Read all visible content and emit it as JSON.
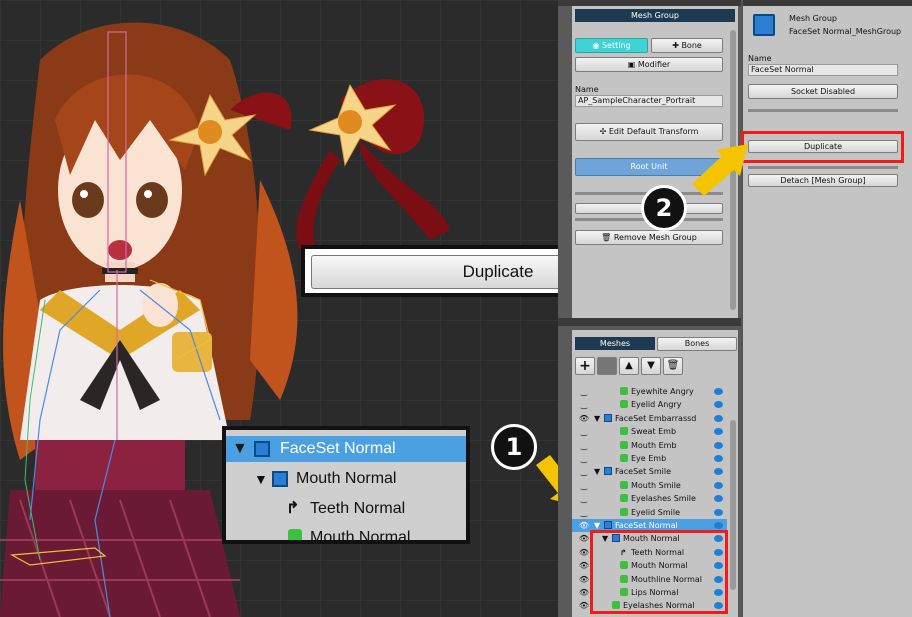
{
  "mid": {
    "header": "Mesh Group",
    "btn_setting": "Setting",
    "btn_bone": "Bone",
    "btn_modifier": "Modifier",
    "name_label": "Name",
    "name_value": "AP_SampleCharacter_Portrait",
    "btn_edit_default": "Edit Default Transform",
    "root_unit": "Root Unit",
    "btn_remove": "Remove Mesh Group",
    "tab_meshes": "Meshes",
    "tab_bones": "Bones"
  },
  "tree": [
    {
      "label": "Eyewhite Angry",
      "icon": "mesh",
      "indent": 2,
      "eye": "closed"
    },
    {
      "label": "Eyelid Angry",
      "icon": "mesh",
      "indent": 2,
      "eye": "closed"
    },
    {
      "label": "FaceSet Embarrassd",
      "icon": "group",
      "indent": 0,
      "eye": "open"
    },
    {
      "label": "Sweat Emb",
      "icon": "mesh",
      "indent": 2,
      "eye": "closed"
    },
    {
      "label": "Mouth Emb",
      "icon": "mesh",
      "indent": 2,
      "eye": "closed"
    },
    {
      "label": "Eye Emb",
      "icon": "mesh",
      "indent": 2,
      "eye": "closed"
    },
    {
      "label": "FaceSet Smile",
      "icon": "group",
      "indent": 0,
      "eye": "closed"
    },
    {
      "label": "Mouth Smile",
      "icon": "mesh",
      "indent": 2,
      "eye": "closed"
    },
    {
      "label": "Eyelashes Smile",
      "icon": "mesh",
      "indent": 2,
      "eye": "closed"
    },
    {
      "label": "Eyelid Smile",
      "icon": "mesh",
      "indent": 2,
      "eye": "closed"
    },
    {
      "label": "FaceSet Normal",
      "icon": "group",
      "indent": 0,
      "eye": "open",
      "selected": true
    },
    {
      "label": "Mouth Normal",
      "icon": "group",
      "indent": 1,
      "eye": "open"
    },
    {
      "label": "Teeth Normal",
      "icon": "bone",
      "indent": 2,
      "eye": "open"
    },
    {
      "label": "Mouth Normal",
      "icon": "mesh",
      "indent": 2,
      "eye": "open"
    },
    {
      "label": "Mouthline Normal",
      "icon": "mesh",
      "indent": 2,
      "eye": "open"
    },
    {
      "label": "Lips Normal",
      "icon": "mesh",
      "indent": 2,
      "eye": "open"
    },
    {
      "label": "Eyelashes Normal",
      "icon": "mesh",
      "indent": 1,
      "eye": "open"
    }
  ],
  "right": {
    "type": "Mesh Group",
    "title": "FaceSet Normal_MeshGroup",
    "name_label": "Name",
    "name_value": "FaceSet Normal",
    "btn_socket": "Socket Disabled",
    "btn_duplicate": "Duplicate",
    "btn_detach": "Detach [Mesh Group]"
  },
  "callouts": {
    "duplicate_zoom": "Duplicate",
    "tree_zoom": [
      "FaceSet Normal",
      "Mouth Normal",
      "Teeth Normal",
      "Mouth Normal"
    ],
    "step1": "1",
    "step2": "2"
  },
  "colors": {
    "highlight": "#ee1c1c",
    "arrow": "#f5c400",
    "selection": "#4aa0e0"
  }
}
